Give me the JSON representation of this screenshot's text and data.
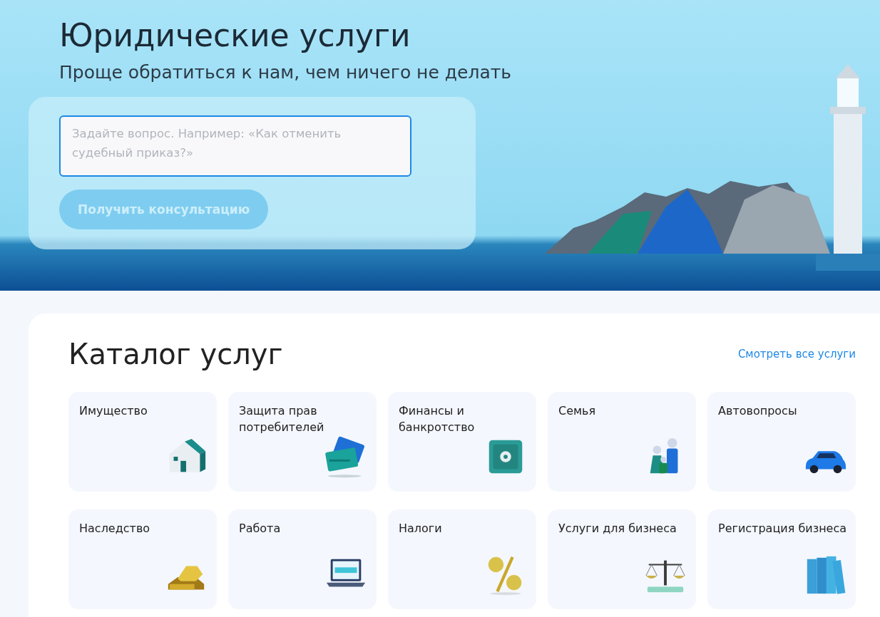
{
  "hero": {
    "title": "Юридические услуги",
    "subtitle": "Проще обратиться к нам, чем ничего не делать",
    "question": {
      "placeholder": "Задайте вопрос. Например: «Как отменить судебный приказ?»",
      "focused": true
    },
    "submit": {
      "label": "Получить консультацию",
      "disabled": true
    }
  },
  "catalog": {
    "title": "Каталог услуг",
    "all_link": "Смотреть все услуги",
    "items": [
      {
        "label": "Имущество"
      },
      {
        "label": "Защита прав потребителей"
      },
      {
        "label": "Финансы и банкротство"
      },
      {
        "label": "Семья"
      },
      {
        "label": "Автовопросы"
      },
      {
        "label": "Наследство"
      },
      {
        "label": "Работа"
      },
      {
        "label": "Налоги"
      },
      {
        "label": "Услуги для бизнеса"
      },
      {
        "label": "Регистрация бизнеса"
      }
    ]
  }
}
